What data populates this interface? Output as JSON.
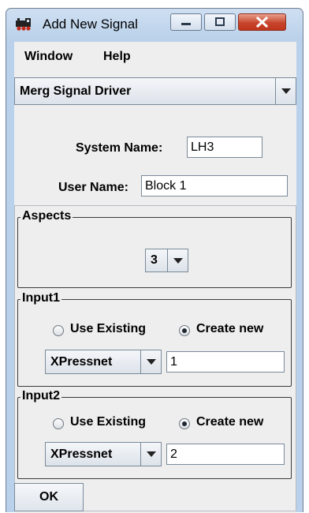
{
  "window": {
    "title": "Add New Signal",
    "icon": "train-icon",
    "controls": [
      "minimize-icon",
      "maximize-icon",
      "close-icon"
    ]
  },
  "menubar": {
    "items": [
      "Window",
      "Help"
    ]
  },
  "driver_select": {
    "value": "Merg Signal Driver"
  },
  "system_name": {
    "label": "System Name:",
    "value": "LH3"
  },
  "user_name": {
    "label": "User Name:",
    "value": "Block 1"
  },
  "aspects": {
    "title": "Aspects",
    "value": "3"
  },
  "inputs": [
    {
      "title": "Input1",
      "option_existing": "Use Existing",
      "option_new": "Create new",
      "selected": "Create new",
      "connection": "XPressnet",
      "value": "1"
    },
    {
      "title": "Input2",
      "option_existing": "Use Existing",
      "option_new": "Create new",
      "selected": "Create new",
      "connection": "XPressnet",
      "value": "2"
    }
  ],
  "ok_button": {
    "label": "OK"
  }
}
